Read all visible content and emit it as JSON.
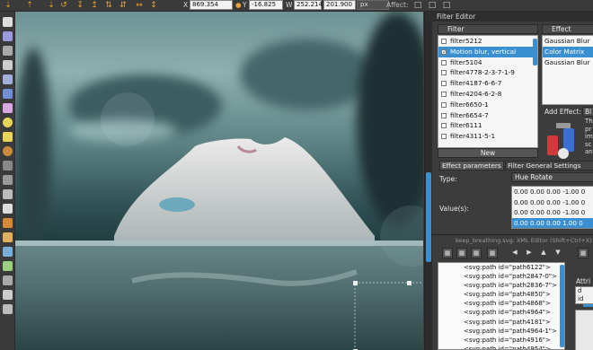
{
  "toolbar": {
    "x_label": "X",
    "x_value": "869.354",
    "y_label": "Y",
    "y_value": "-16.825",
    "w_label": "W",
    "w_value": "252.214",
    "h_label": "H",
    "h_value": "201.900",
    "unit": "px",
    "affect_label": "Affect:"
  },
  "filter_editor": {
    "panel_title": "Filter Editor",
    "filter_header": "Filter",
    "filters": [
      {
        "name": "filter5212",
        "checked": false
      },
      {
        "name": "Motion blur, vertical",
        "checked": true
      },
      {
        "name": "filter5104",
        "checked": false
      },
      {
        "name": "filter4778-2-3-7-1-9",
        "checked": false
      },
      {
        "name": "filter4187-6-6-7",
        "checked": false
      },
      {
        "name": "filter4204-6-2-8",
        "checked": false
      },
      {
        "name": "filter6650-1",
        "checked": false
      },
      {
        "name": "filter6654-7",
        "checked": false
      },
      {
        "name": "filter6111",
        "checked": false
      },
      {
        "name": "filter4311-5-1",
        "checked": false
      }
    ],
    "new_button": "New",
    "effect_header": "Effect",
    "effects": [
      "Gaussian Blur",
      "Color Matrix",
      "Gaussian Blur"
    ],
    "add_effect_label": "Add Effect:",
    "add_effect_value": "Bl",
    "help_text_lines": [
      "Th",
      "pr",
      "im",
      "sc",
      "an"
    ],
    "tab_params": "Effect parameters",
    "tab_general": "Filter General Settings",
    "type_label": "Type:",
    "type_value": "Hue Rotate",
    "values_label": "Value(s):",
    "matrix_rows": [
      "0.00 0.00 0.00 -1.00 0",
      "0.00 0.00 0.00 -1.00 0",
      "0.00 0.00 0.00 -1.00 0",
      "0.00 0.00 0.00 1.00 0"
    ]
  },
  "xml_editor": {
    "title": "keep_breathing.svg: XML Editor (Shift+Ctrl+X)",
    "nodes": [
      "<svg:path id=\"path6122\">",
      "<svg:path id=\"path2847-0\">",
      "<svg:path id=\"path2836-7\">",
      "<svg:path id=\"path4850\">",
      "<svg:path id=\"path4868\">",
      "<svg:path id=\"path4964\">",
      "<svg:path id=\"path4181\">",
      "<svg:path id=\"path4964-1\">",
      "<svg:path id=\"path4916\">",
      "<svg:path id=\"path4954\">"
    ],
    "attr_label": "Attri",
    "attr_value_1": "d",
    "attr_value_2": "id"
  },
  "colors": {
    "accent": "#3a8fd0",
    "panel_bg": "#3c3c3c",
    "toolbar_icon": "#e8a23a"
  }
}
